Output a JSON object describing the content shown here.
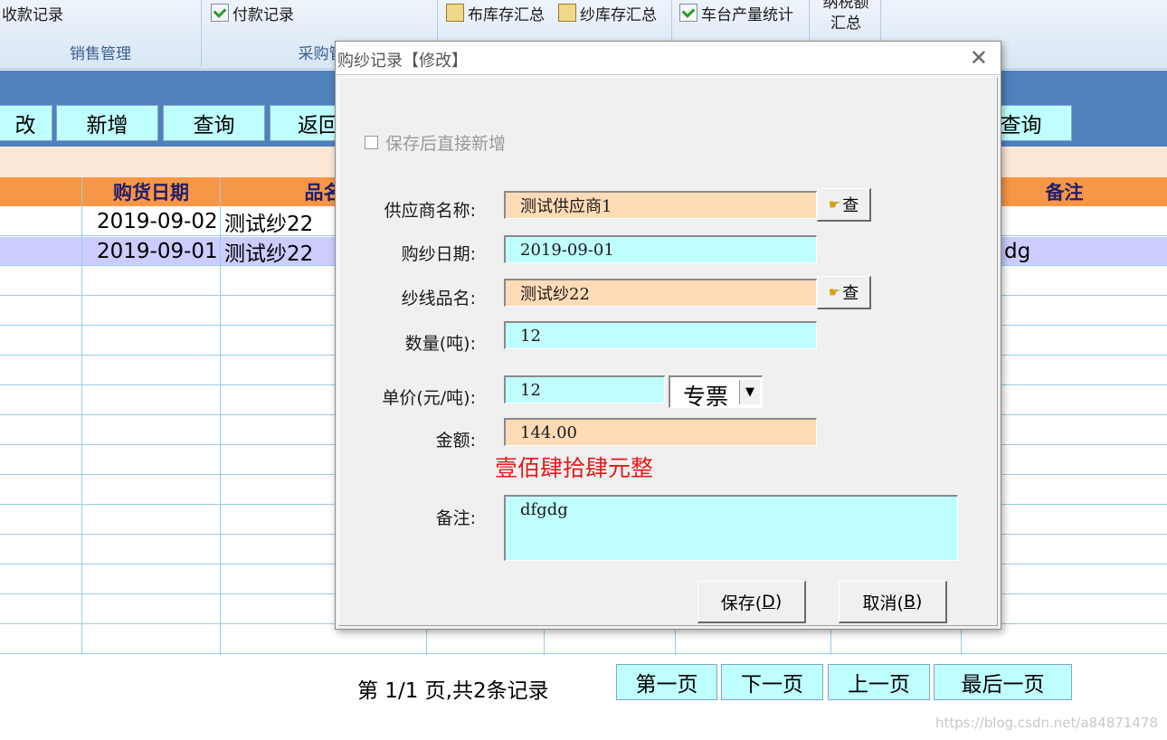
{
  "ribbon": {
    "sales": {
      "button": "收款记录",
      "group": "销售管理"
    },
    "purchase": {
      "button": "付款记录",
      "group": "采购管"
    },
    "cloth_stock": "布库存汇总",
    "yarn_stock": "纱库存汇总",
    "machine_output": "车台产量统计",
    "tax_line1": "纳税额",
    "tax_line2": "汇总"
  },
  "toolbar": {
    "edit": "改",
    "add": "新增",
    "query": "查询",
    "back": "返回",
    "query2": "查询"
  },
  "grid": {
    "headers": {
      "date": "购货日期",
      "name": "品名",
      "note": "备注"
    },
    "rows": [
      {
        "date": "2019-09-02",
        "name": "测试纱22",
        "note": ""
      },
      {
        "date": "2019-09-01",
        "name": "测试纱22",
        "note": "dg"
      }
    ]
  },
  "pager": {
    "info": "第 1/1 页,共2条记录",
    "first": "第一页",
    "next": "下一页",
    "prev": "上一页",
    "last": "最后一页"
  },
  "watermark": "https://blog.csdn.net/a84871478",
  "dialog": {
    "title": "购纱记录【修改】",
    "close": "✕",
    "save_then_new": "保存后直接新增",
    "supplier_label": "供应商名称:",
    "supplier_value": "测试供应商1",
    "lookup_label": "查",
    "date_label": "购纱日期:",
    "date_value": "2019-09-01",
    "yarn_label": "纱线品名:",
    "yarn_value": "测试纱22",
    "qty_label": "数量(吨):",
    "qty_value": "12",
    "price_label": "单价(元/吨):",
    "price_value": "12",
    "invoice_value": "专票",
    "amount_label": "金额:",
    "amount_value": "144.00",
    "amount_words": "壹佰肆拾肆元整",
    "note_label": "备注:",
    "note_value": "dfgdg",
    "save_text": "保存(",
    "save_key": "D",
    "cancel_text": "取消(",
    "cancel_key": "B",
    "close_paren": ")"
  }
}
